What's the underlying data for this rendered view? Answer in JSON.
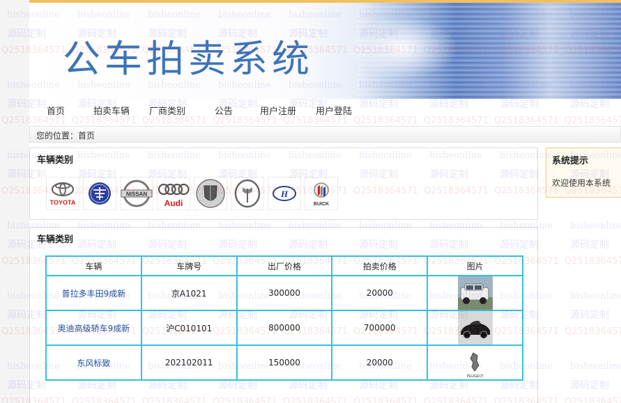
{
  "site": {
    "title": "公车拍卖系统"
  },
  "nav": {
    "items": [
      {
        "label": "首页"
      },
      {
        "label": "拍卖车辆"
      },
      {
        "label": "厂商类别"
      },
      {
        "label": "公告"
      },
      {
        "label": "用户注册"
      },
      {
        "label": "用户登陆"
      }
    ]
  },
  "breadcrumb": {
    "text": "您的位置：首页"
  },
  "brand_panel": {
    "title": "车辆类别",
    "brands": [
      {
        "name": "TOYOTA",
        "icon": "toyota-logo"
      },
      {
        "name": "FAW",
        "icon": "faw-logo"
      },
      {
        "name": "NISSAN",
        "icon": "nissan-logo"
      },
      {
        "name": "Audi",
        "icon": "audi-logo"
      },
      {
        "name": "Roewe",
        "icon": "roewe-logo"
      },
      {
        "name": "Hongqi",
        "icon": "hongqi-logo"
      },
      {
        "name": "Hyundai",
        "icon": "hyundai-logo"
      },
      {
        "name": "BUICK",
        "icon": "buick-logo"
      }
    ]
  },
  "tip_panel": {
    "title": "系统提示",
    "text": "欢迎使用本系统"
  },
  "list_panel": {
    "title": "车辆类别",
    "columns": [
      "车辆",
      "车牌号",
      "出厂价格",
      "拍卖价格",
      "图片"
    ],
    "rows": [
      {
        "name": "普拉多丰田9成新",
        "plate": "京A1021",
        "factory_price": "300000",
        "auction_price": "20000",
        "image": "suv-photo"
      },
      {
        "name": "奥迪高级轿车9成新",
        "plate": "沪C010101",
        "factory_price": "800000",
        "auction_price": "700000",
        "image": "sports-car-photo"
      },
      {
        "name": "东风标致",
        "plate": "202102011",
        "factory_price": "150000",
        "auction_price": "20000",
        "image": "peugeot-logo"
      }
    ]
  },
  "watermark": {
    "line1": "bisheonline",
    "line2": "源码定制",
    "line3": "Q2518364571"
  },
  "colors": {
    "title": "#3d74b8",
    "table_border": "#33c0e0",
    "link": "#1f4fa0"
  }
}
